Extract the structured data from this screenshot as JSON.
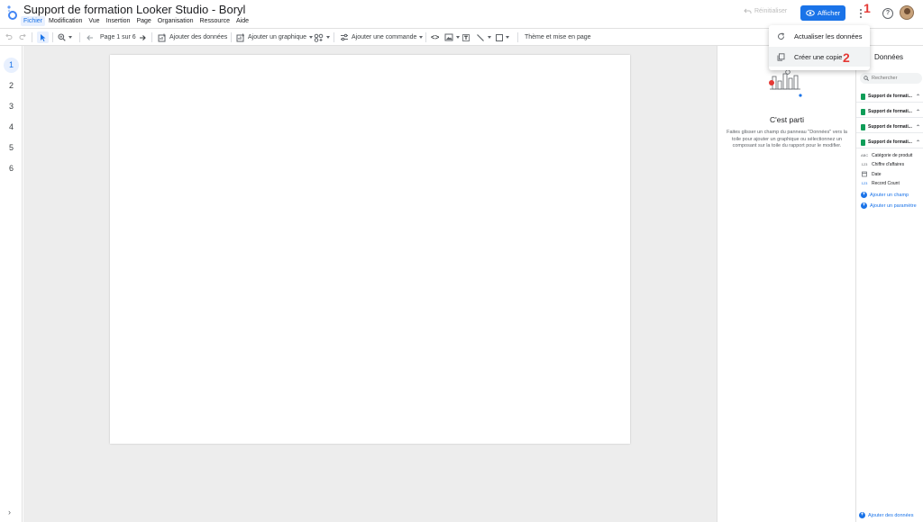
{
  "header": {
    "title": "Support de formation Looker Studio - Boryl",
    "menu": [
      "Fichier",
      "Modification",
      "Vue",
      "Insertion",
      "Page",
      "Organisation",
      "Ressource",
      "Aide"
    ],
    "reset_label": "Réinitialiser",
    "view_label": "Afficher"
  },
  "annotations": {
    "one": "1",
    "two": "2"
  },
  "toolbar": {
    "page_label": "Page 1 sur 6",
    "add_data": "Ajouter des données",
    "add_chart": "Ajouter un graphique",
    "add_control": "Ajouter une commande",
    "theme": "Thème et mise en page"
  },
  "pages": [
    "1",
    "2",
    "3",
    "4",
    "5",
    "6"
  ],
  "properties": {
    "title": "C'est parti",
    "description": "Faites glisser un champ du panneau \"Données\" vers la toile pour ajouter un graphique ou sélectionnez un composant sur la toile du rapport pour le modifier."
  },
  "data_panel": {
    "title": "Données",
    "search_placeholder": "Rechercher",
    "sources": [
      "Support de formati...",
      "Support de formati...",
      "Support de formati...",
      "Support de formati..."
    ],
    "fields": [
      {
        "type": "ABC",
        "name": "Catégorie de produit"
      },
      {
        "type": "123",
        "name": "Chiffre d'affaires"
      },
      {
        "type": "cal",
        "name": "Date"
      },
      {
        "type": "123",
        "name": "Record Count"
      }
    ],
    "add_field": "Ajouter un champ",
    "add_param": "Ajouter un paramètre",
    "add_data_footer": "Ajouter des données"
  },
  "dropdown": {
    "refresh": "Actualiser les données",
    "copy": "Créer une copie"
  },
  "colors": {
    "accent": "#1a73e8",
    "annotation": "#e53935",
    "sheets": "#0f9d58"
  }
}
